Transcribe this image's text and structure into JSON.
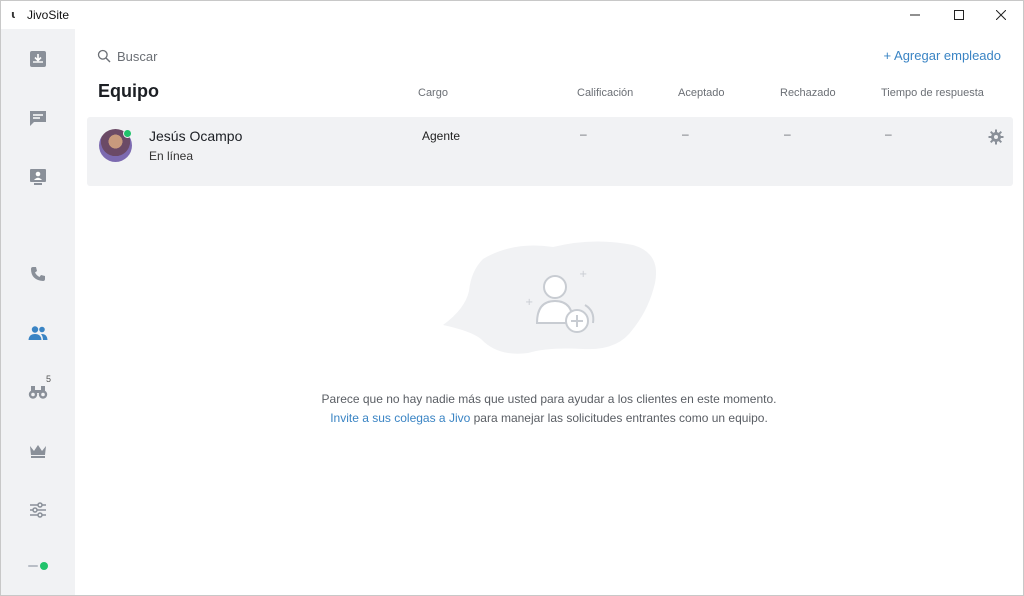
{
  "app": {
    "title": "JivoSite",
    "logo_glyph": "ɩ"
  },
  "window_controls": {
    "minimize": "minimize",
    "maximize": "maximize",
    "close": "close"
  },
  "sidebar": {
    "items": [
      {
        "id": "inbox",
        "icon": "inbox-icon"
      },
      {
        "id": "chats",
        "icon": "chat-icon"
      },
      {
        "id": "visitors",
        "icon": "visitor-board-icon"
      },
      {
        "id": "calls",
        "icon": "phone-icon"
      },
      {
        "id": "team",
        "icon": "team-icon",
        "active": true
      },
      {
        "id": "monitoring",
        "icon": "binoculars-icon",
        "badge": "5"
      },
      {
        "id": "premium",
        "icon": "crown-icon"
      },
      {
        "id": "settings",
        "icon": "sliders-icon"
      }
    ],
    "status_color": "#21c36b"
  },
  "search": {
    "placeholder": "Buscar"
  },
  "add_employee": "+ Agregar empleado",
  "page_title": "Equipo",
  "columns": [
    "Cargo",
    "Calificación",
    "Aceptado",
    "Rechazado",
    "Tiempo de respuesta"
  ],
  "employees": [
    {
      "name": "Jesús Ocampo",
      "status": "En línea",
      "role": "Agente",
      "rating": "–",
      "accepted": "–",
      "rejected": "–",
      "response_time": "–"
    }
  ],
  "empty_state": {
    "line1": "Parece que no hay nadie más que usted para ayudar a los clientes en este momento.",
    "invite_link": "Invite a sus colegas a Jivo",
    "line2_rest": " para manejar las solicitudes entrantes como un equipo."
  },
  "colors": {
    "accent": "#3a84c4",
    "online": "#21c36b",
    "sidebar_bg": "#f1f2f4",
    "icon": "#8a9099"
  }
}
